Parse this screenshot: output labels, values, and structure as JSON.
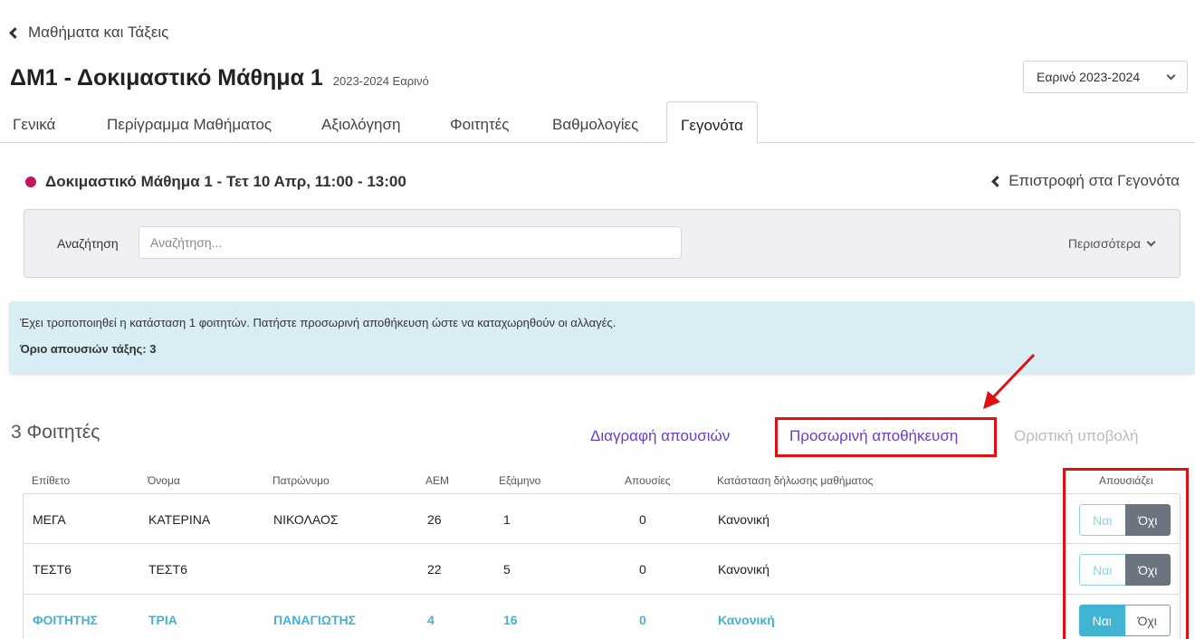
{
  "breadcrumb": {
    "back_label": "Μαθήματα και Τάξεις"
  },
  "header": {
    "title": "ΔΜ1 - Δοκιμαστικό Μάθημα 1",
    "semester": "2023-2024 Εαρινό",
    "semester_select": "Εαρινό 2023-2024"
  },
  "tabs": [
    {
      "label": "Γενικά"
    },
    {
      "label": "Περίγραμμα Μαθήματος"
    },
    {
      "label": "Αξιολόγηση"
    },
    {
      "label": "Φοιτητές"
    },
    {
      "label": "Βαθμολογίες"
    },
    {
      "label": "Γεγονότα",
      "active": true
    }
  ],
  "event": {
    "title": "Δοκιμαστικό Μάθημα 1 - Τετ 10 Απρ, 11:00 - 13:00",
    "color": "#c2185b",
    "return_label": "Επιστροφή στα Γεγονότα"
  },
  "search": {
    "label": "Αναζήτηση",
    "placeholder": "Αναζήτηση...",
    "more_label": "Περισσότερα"
  },
  "alert": {
    "message": "Έχει τροποποιηθεί η κατάσταση 1 φοιτητών. Πατήστε προσωρινή αποθήκευση ώστε να καταχωρηθούν οι αλλαγές.",
    "limit_label": "Όριο απουσιών τάξης:",
    "limit_value": "3"
  },
  "students": {
    "count_label": "3 Φοιτητές",
    "actions": {
      "delete": "Διαγραφή απουσιών",
      "temp_save": "Προσωρινή αποθήκευση",
      "final_submit": "Οριστική υποβολή"
    },
    "columns": [
      "Επίθετο",
      "Όνομα",
      "Πατρώνυμο",
      "ΑΕΜ",
      "Εξάμηνο",
      "Απουσίες",
      "Κατάσταση δήλωσης μαθήματος",
      "Απουσιάζει"
    ],
    "toggle_labels": {
      "yes": "Ναι",
      "no": "Όχι"
    },
    "rows": [
      {
        "surname": "ΜΕΓΑ",
        "name": "ΚΑΤΕΡΙΝΑ",
        "father": "ΝΙΚΟΛΑΟΣ",
        "aem": "26",
        "semester": "1",
        "absences": "0",
        "status": "Κανονική",
        "absent": "no"
      },
      {
        "surname": "ΤΕΣΤ6",
        "name": "ΤΕΣΤ6",
        "father": "",
        "aem": "22",
        "semester": "5",
        "absences": "0",
        "status": "Κανονική",
        "absent": "no"
      },
      {
        "surname": "ΦΟΙΤΗΤΗΣ",
        "name": "ΤΡΙΑ",
        "father": "ΠΑΝΑΓΙΩΤΗΣ",
        "aem": "4",
        "semester": "16",
        "absences": "0",
        "status": "Κανονική",
        "absent": "yes"
      }
    ]
  },
  "colors": {
    "accent_purple": "#6b3fc8",
    "highlight_red": "#e10f0f",
    "selected_blue": "#41b3d3",
    "toggle_dark": "#6c7480"
  }
}
